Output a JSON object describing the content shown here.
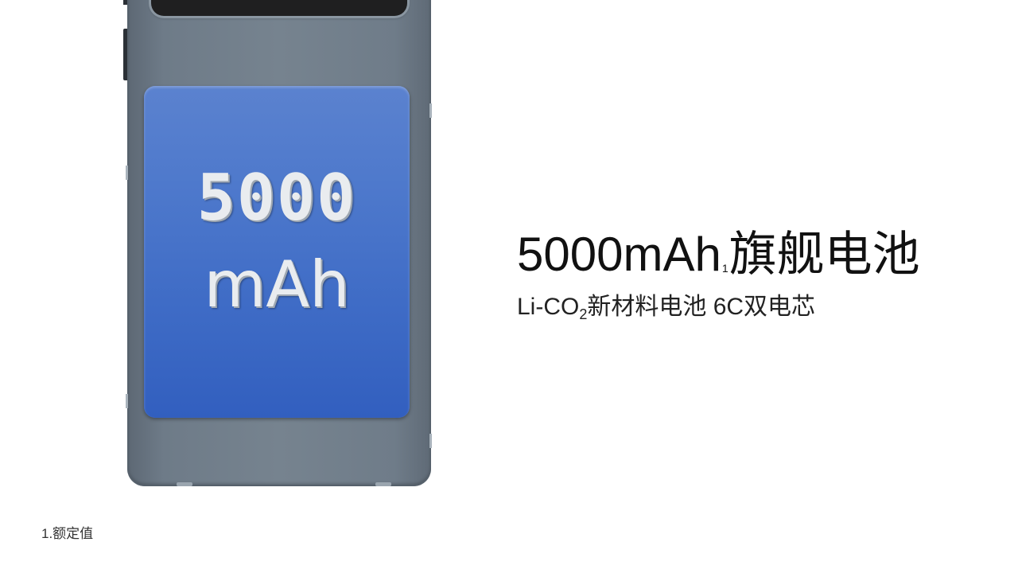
{
  "battery_panel": {
    "capacity": "5000",
    "unit": "mAh"
  },
  "headline": {
    "main": "5000mAh",
    "footnote_ref": "1",
    "suffix": "旗舰电池"
  },
  "subline": {
    "prefix": "Li-CO",
    "subscript": "2",
    "suffix": "新材料电池 6C双电芯"
  },
  "footnote": {
    "text": "1.额定值"
  },
  "colors": {
    "phone_body": "#76838f",
    "battery_blue": "#4e79cc",
    "text": "#111111",
    "background": "#ffffff"
  }
}
